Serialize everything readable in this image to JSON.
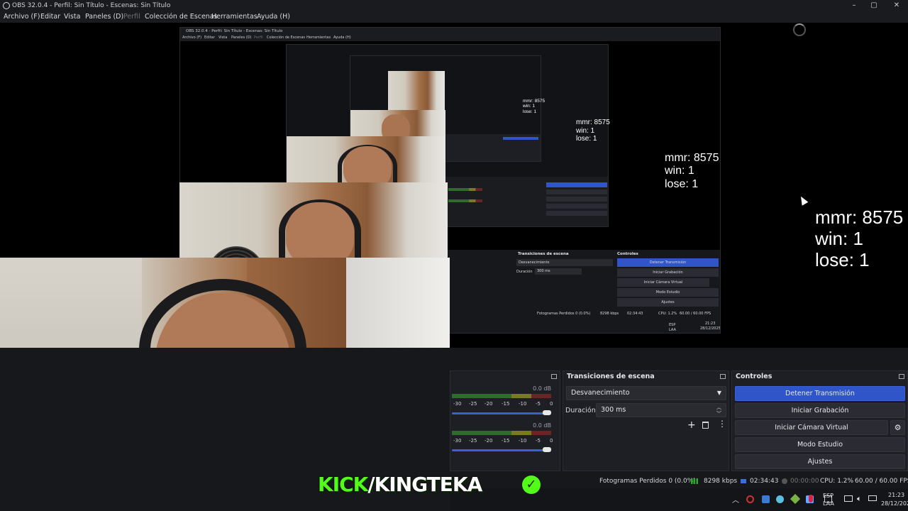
{
  "window": {
    "title": "OBS 32.0.4 - Perfil: Sin Título - Escenas: Sin Título",
    "minimize": "–",
    "maximize": "▢",
    "close": "✕"
  },
  "menu": {
    "items": [
      "Archivo (F)",
      "Editar",
      "Vista",
      "Paneles (D)",
      "Perfil",
      "Colección de Escenas",
      "Herramientas",
      "Ayuda (H)"
    ]
  },
  "nested": {
    "title": "OBS 32.0.4 - Perfil: Sin Título - Escenas: Sin Título",
    "menu": [
      "Archivo (F)",
      "Editar",
      "Vista",
      "Paneles (D)",
      "Perfil",
      "Colección de Escenas",
      "Herramientas",
      "Ayuda (H)"
    ],
    "transitions_title": "Transiciones de escena",
    "transition": "Desvanecimiento",
    "duration_label": "Duración",
    "duration": "300 ms",
    "controls_title": "Controles",
    "stop_stream": "Detener Transmisión",
    "start_rec": "Iniciar Grabación",
    "start_vcam": "Iniciar Cámara Virtual",
    "studio": "Modo Estudio",
    "settings": "Ajustes",
    "dropped": "Fotogramas Perdidos 0 (0.0%)",
    "kbps": "8298 kbps",
    "time": "02:34:43",
    "cpu": "CPU: 1.2%",
    "fps": "60.00 / 60.00 FPS",
    "lang": "ESP",
    "lang2": "LAA",
    "clock": "21:23",
    "date": "28/12/2025"
  },
  "overlays": {
    "large": [
      "mmr: 8575",
      "win: 1",
      "lose: 1"
    ],
    "medium": [
      "mmr: 8575",
      "win: 1",
      "lose: 1"
    ],
    "small": [
      "mmr: 8575",
      "win: 1",
      "lose: 1"
    ],
    "tiny": [
      "mmr: 8575",
      "win: 1",
      "lose: 1"
    ]
  },
  "mixer": {
    "level1": "0.0 dB",
    "level2": "0.0 dB",
    "ticks": [
      "-30",
      "-25",
      "-20",
      "-15",
      "-10",
      "-5",
      "0"
    ]
  },
  "transitions": {
    "title": "Transiciones de escena",
    "selected": "Desvanecimiento",
    "duration_label": "Duración",
    "duration": "300 ms"
  },
  "controls": {
    "title": "Controles",
    "stop_stream": "Detener Transmisión",
    "start_recording": "Iniciar Grabación",
    "start_virtual_cam": "Iniciar Cámara Virtual",
    "studio_mode": "Modo Estudio",
    "settings": "Ajustes"
  },
  "status": {
    "dropped_frames": "Fotogramas Perdidos 0 (0.0%)",
    "bitrate": "8298 kbps",
    "stream_time": "02:34:43",
    "rec_time": "00:00:00",
    "cpu": "CPU: 1.2%",
    "fps": "60.00 / 60.00 FPS"
  },
  "taskbar": {
    "lang": "ESP",
    "lang2": "LAA",
    "time": "21:23",
    "date": "28/12/2025"
  },
  "branding": {
    "kick": "KICK",
    "slash_name": "/KINGTEKA",
    "check": "✓",
    "kick_color": "#53fc18"
  }
}
